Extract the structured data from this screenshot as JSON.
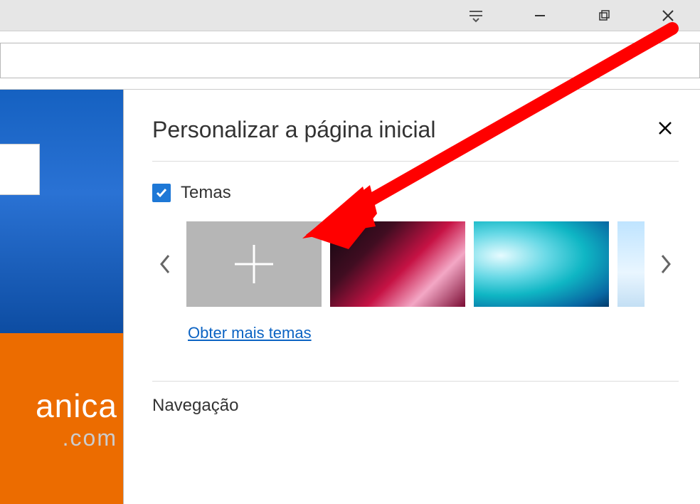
{
  "titlebar": {
    "hub_icon": "hub-icon",
    "minimize": "—",
    "maximize": "❐",
    "close": "✕"
  },
  "addressbar": {
    "placeholder": ""
  },
  "left": {
    "brand_text": "anica",
    "brand_domain": ".com"
  },
  "panel": {
    "title": "Personalizar a página inicial",
    "close": "✕",
    "themes_label": "Temas",
    "themes_checked": true,
    "add_theme": "+",
    "get_more_link": "Obter mais temas",
    "nav_label": "Navegação"
  },
  "annotation": {
    "type": "arrow",
    "color": "#ff0000"
  }
}
